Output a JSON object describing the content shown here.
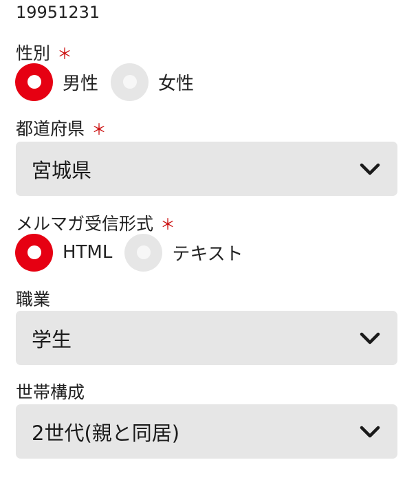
{
  "birthdate": {
    "value": "19951231"
  },
  "gender": {
    "label": "性別",
    "required_mark": "＊",
    "options": [
      {
        "label": "男性",
        "selected": true
      },
      {
        "label": "女性",
        "selected": false
      }
    ]
  },
  "prefecture": {
    "label": "都道府県",
    "required_mark": "＊",
    "value": "宮城県"
  },
  "newsletter_format": {
    "label": "メルマガ受信形式",
    "required_mark": "＊",
    "options": [
      {
        "label": "HTML",
        "selected": true
      },
      {
        "label": "テキスト",
        "selected": false
      }
    ]
  },
  "occupation": {
    "label": "職業",
    "value": "学生"
  },
  "household": {
    "label": "世帯構成",
    "value": "2世代(親と同居)"
  },
  "colors": {
    "accent": "#e60012",
    "required": "#cc1111",
    "field_bg": "#e6e6e6"
  },
  "icons": {
    "select_arrow": "chevron-down-icon"
  }
}
